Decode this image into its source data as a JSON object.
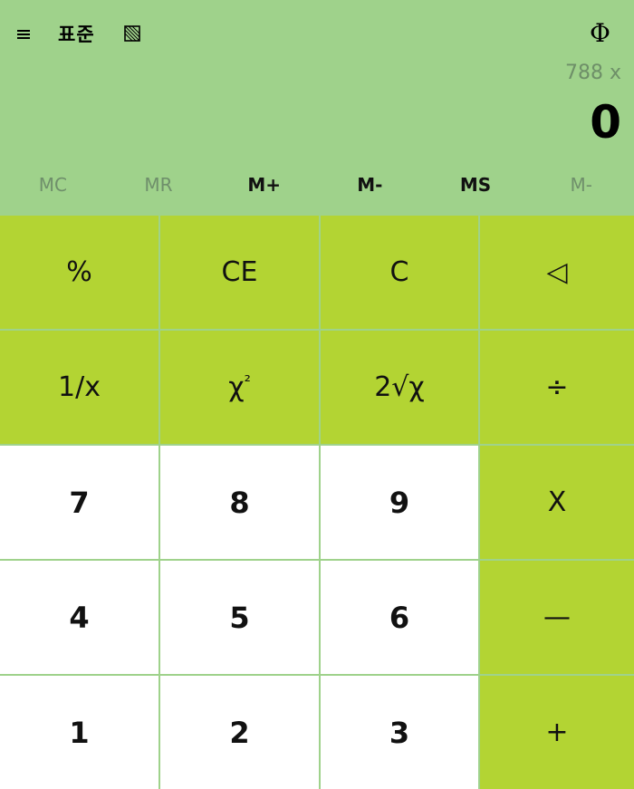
{
  "header": {
    "mode_title": "표준",
    "menu_icon": "hamburger-icon",
    "keep_on_top_icon": "keep-on-top-icon",
    "history_icon": "phi-history-icon",
    "history_label": "Φ"
  },
  "display": {
    "expression": "788 x",
    "result": "0"
  },
  "memory": {
    "mc": "MC",
    "mr": "MR",
    "mplus": "M+",
    "mminus": "M-",
    "ms": "MS",
    "mlist": "M-"
  },
  "keys": {
    "percent": "%",
    "ce": "CE",
    "c": "C",
    "backspace": "◁",
    "reciprocal": "1/x",
    "square_base": "χ",
    "square_exp": "²",
    "sqrt": "2√χ",
    "divide": "÷",
    "seven": "7",
    "eight": "8",
    "nine": "9",
    "multiply": "X",
    "four": "4",
    "five": "5",
    "six": "6",
    "subtract": "—",
    "one": "1",
    "two": "2",
    "three": "3",
    "add": "+"
  },
  "colors": {
    "background": "#9fd28b",
    "function_key": "#b3d433",
    "number_key": "#ffffff"
  }
}
